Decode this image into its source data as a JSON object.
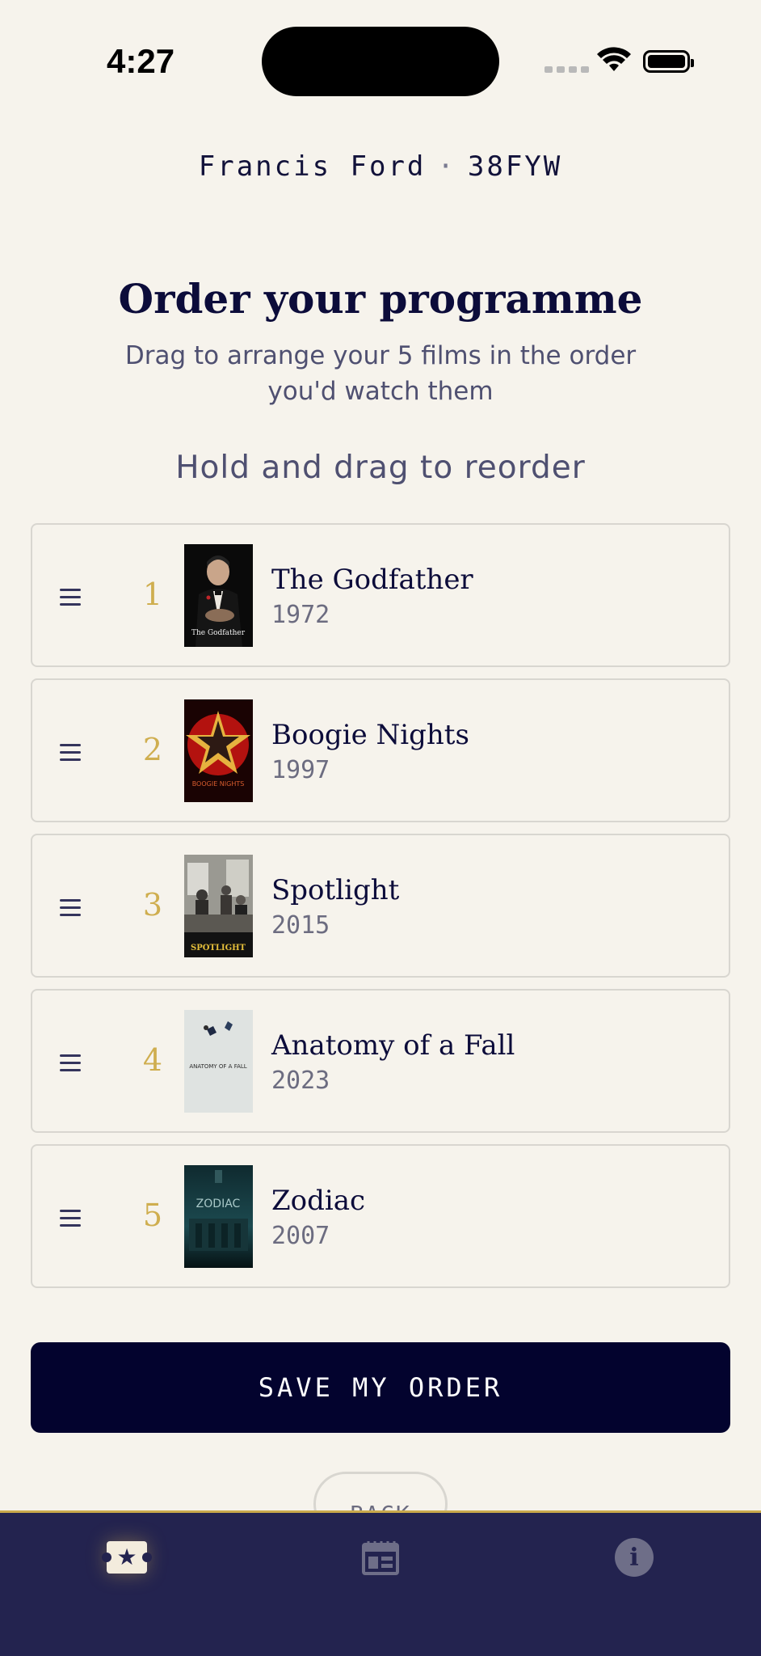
{
  "status_bar": {
    "time": "4:27"
  },
  "user": {
    "name": "Francis Ford",
    "separator": "·",
    "code": "38FYW"
  },
  "header": {
    "title": "Order your programme",
    "subtitle": "Drag to arrange your 5 films in the order you'd watch them",
    "hint": "Hold and drag to reorder"
  },
  "films": [
    {
      "rank": "1",
      "title": "The Godfather",
      "year": "1972",
      "poster_text": "The Godfather"
    },
    {
      "rank": "2",
      "title": "Boogie Nights",
      "year": "1997",
      "poster_text": "BOOGIE NIGHTS"
    },
    {
      "rank": "3",
      "title": "Spotlight",
      "year": "2015",
      "poster_text": "SPOTLIGHT"
    },
    {
      "rank": "4",
      "title": "Anatomy of a Fall",
      "year": "2023",
      "poster_text": "ANATOMY OF A FALL"
    },
    {
      "rank": "5",
      "title": "Zodiac",
      "year": "2007",
      "poster_text": "ZODIAC"
    }
  ],
  "actions": {
    "save_label": "SAVE MY ORDER",
    "back_label": "BACK"
  },
  "tab_bar": {
    "tabs": [
      {
        "icon": "ticket-star-icon",
        "active": true
      },
      {
        "icon": "calendar-icon",
        "active": false
      },
      {
        "icon": "info-icon",
        "active": false
      }
    ]
  },
  "colors": {
    "background": "#f6f3ec",
    "navy": "#03032e",
    "tab_bar": "#23234f",
    "gold": "#cfae4f"
  }
}
